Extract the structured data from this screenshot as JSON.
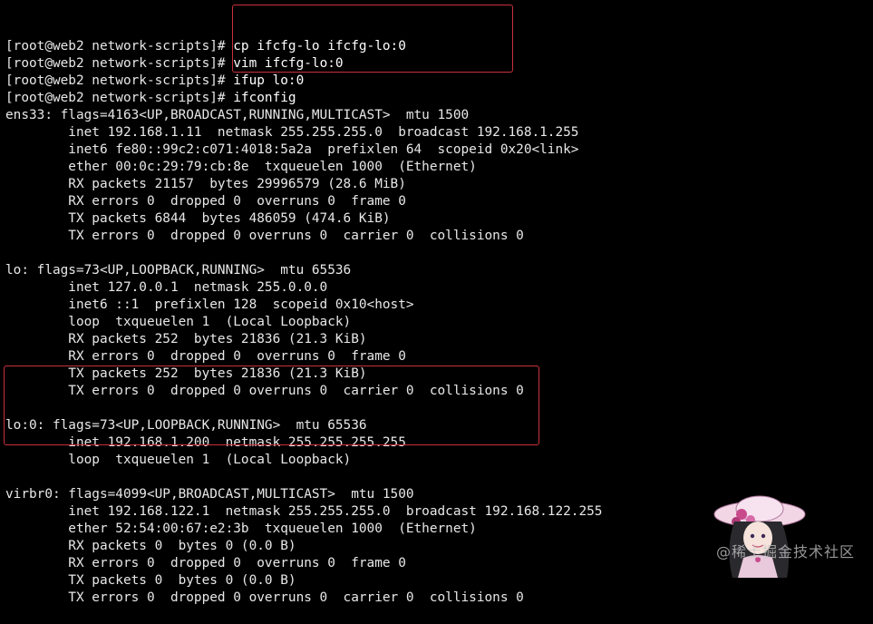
{
  "terminal": {
    "lines": [
      {
        "prompt": "[root@web2 network-scripts]# ",
        "cmd": "cp ifcfg-lo ifcfg-lo:0"
      },
      {
        "prompt": "[root@web2 network-scripts]# ",
        "cmd": "vim ifcfg-lo:0"
      },
      {
        "prompt": "[root@web2 network-scripts]# ",
        "cmd": "ifup lo:0"
      },
      {
        "prompt": "[root@web2 network-scripts]# ",
        "cmd": "ifconfig"
      },
      {
        "text": "ens33: flags=4163<UP,BROADCAST,RUNNING,MULTICAST>  mtu 1500"
      },
      {
        "text": "        inet 192.168.1.11  netmask 255.255.255.0  broadcast 192.168.1.255"
      },
      {
        "text": "        inet6 fe80::99c2:c071:4018:5a2a  prefixlen 64  scopeid 0x20<link>"
      },
      {
        "text": "        ether 00:0c:29:79:cb:8e  txqueuelen 1000  (Ethernet)"
      },
      {
        "text": "        RX packets 21157  bytes 29996579 (28.6 MiB)"
      },
      {
        "text": "        RX errors 0  dropped 0  overruns 0  frame 0"
      },
      {
        "text": "        TX packets 6844  bytes 486059 (474.6 KiB)"
      },
      {
        "text": "        TX errors 0  dropped 0 overruns 0  carrier 0  collisions 0"
      },
      {
        "text": ""
      },
      {
        "text": "lo: flags=73<UP,LOOPBACK,RUNNING>  mtu 65536"
      },
      {
        "text": "        inet 127.0.0.1  netmask 255.0.0.0"
      },
      {
        "text": "        inet6 ::1  prefixlen 128  scopeid 0x10<host>"
      },
      {
        "text": "        loop  txqueuelen 1  (Local Loopback)"
      },
      {
        "text": "        RX packets 252  bytes 21836 (21.3 KiB)"
      },
      {
        "text": "        RX errors 0  dropped 0  overruns 0  frame 0"
      },
      {
        "text": "        TX packets 252  bytes 21836 (21.3 KiB)"
      },
      {
        "text": "        TX errors 0  dropped 0 overruns 0  carrier 0  collisions 0"
      },
      {
        "text": ""
      },
      {
        "text": "lo:0: flags=73<UP,LOOPBACK,RUNNING>  mtu 65536"
      },
      {
        "text": "        inet 192.168.1.200  netmask 255.255.255.255"
      },
      {
        "text": "        loop  txqueuelen 1  (Local Loopback)"
      },
      {
        "text": ""
      },
      {
        "text": "virbr0: flags=4099<UP,BROADCAST,MULTICAST>  mtu 1500"
      },
      {
        "text": "        inet 192.168.122.1  netmask 255.255.255.0  broadcast 192.168.122.255"
      },
      {
        "text": "        ether 52:54:00:67:e2:3b  txqueuelen 1000  (Ethernet)"
      },
      {
        "text": "        RX packets 0  bytes 0 (0.0 B)"
      },
      {
        "text": "        RX errors 0  dropped 0  overruns 0  frame 0"
      },
      {
        "text": "        TX packets 0  bytes 0 (0.0 B)"
      },
      {
        "text": "        TX errors 0  dropped 0 overruns 0  carrier 0  collisions 0"
      }
    ]
  },
  "watermark": {
    "text": "@稀土掘金技术社区"
  },
  "colors": {
    "background": "#000000",
    "foreground": "#e8e8e8",
    "highlight_border": "#c8323c"
  }
}
